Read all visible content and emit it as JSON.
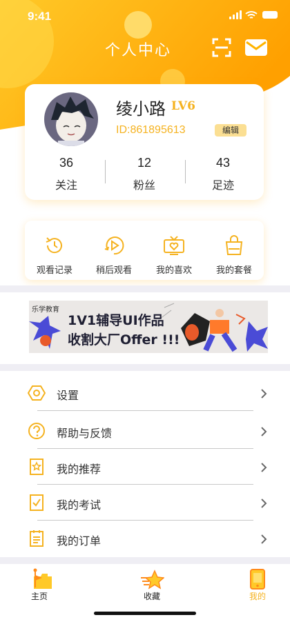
{
  "colors": {
    "accent": "#F5B21F",
    "header_start": "#FFC928",
    "header_end": "#FFA000",
    "background": "#FFFFFF",
    "divider": "#EFEEF4"
  },
  "status_bar": {
    "time": "9:41"
  },
  "header": {
    "title": "个人中心",
    "icons": [
      "scan-icon",
      "mail-icon"
    ]
  },
  "profile": {
    "name": "绫小路",
    "level": "LV6",
    "id_text": "ID:861895613",
    "edit_label": "编辑",
    "stats": [
      {
        "value": "36",
        "label": "关注"
      },
      {
        "value": "12",
        "label": "粉丝"
      },
      {
        "value": "43",
        "label": "足迹"
      }
    ]
  },
  "quick_actions": [
    {
      "label": "观看记录",
      "icon": "history-icon"
    },
    {
      "label": "稍后观看",
      "icon": "play-later-icon"
    },
    {
      "label": "我的喜欢",
      "icon": "heart-tv-icon"
    },
    {
      "label": "我的套餐",
      "icon": "shopping-bag-icon"
    }
  ],
  "banner": {
    "brand": "乐学教育",
    "line1": "1V1辅导UI作品",
    "line2": "收割大厂Offer !!!"
  },
  "menu": [
    {
      "label": "设置",
      "icon": "settings-icon"
    },
    {
      "label": "帮助与反馈",
      "icon": "help-icon"
    },
    {
      "label": "我的推荐",
      "icon": "recommend-icon"
    },
    {
      "label": "我的考试",
      "icon": "exam-icon"
    },
    {
      "label": "我的订单",
      "icon": "order-icon"
    }
  ],
  "tabs": [
    {
      "label": "主页",
      "icon": "home-flag-icon",
      "active": false
    },
    {
      "label": "收藏",
      "icon": "star-folder-icon",
      "active": false
    },
    {
      "label": "我的",
      "icon": "phone-icon",
      "active": true
    }
  ]
}
